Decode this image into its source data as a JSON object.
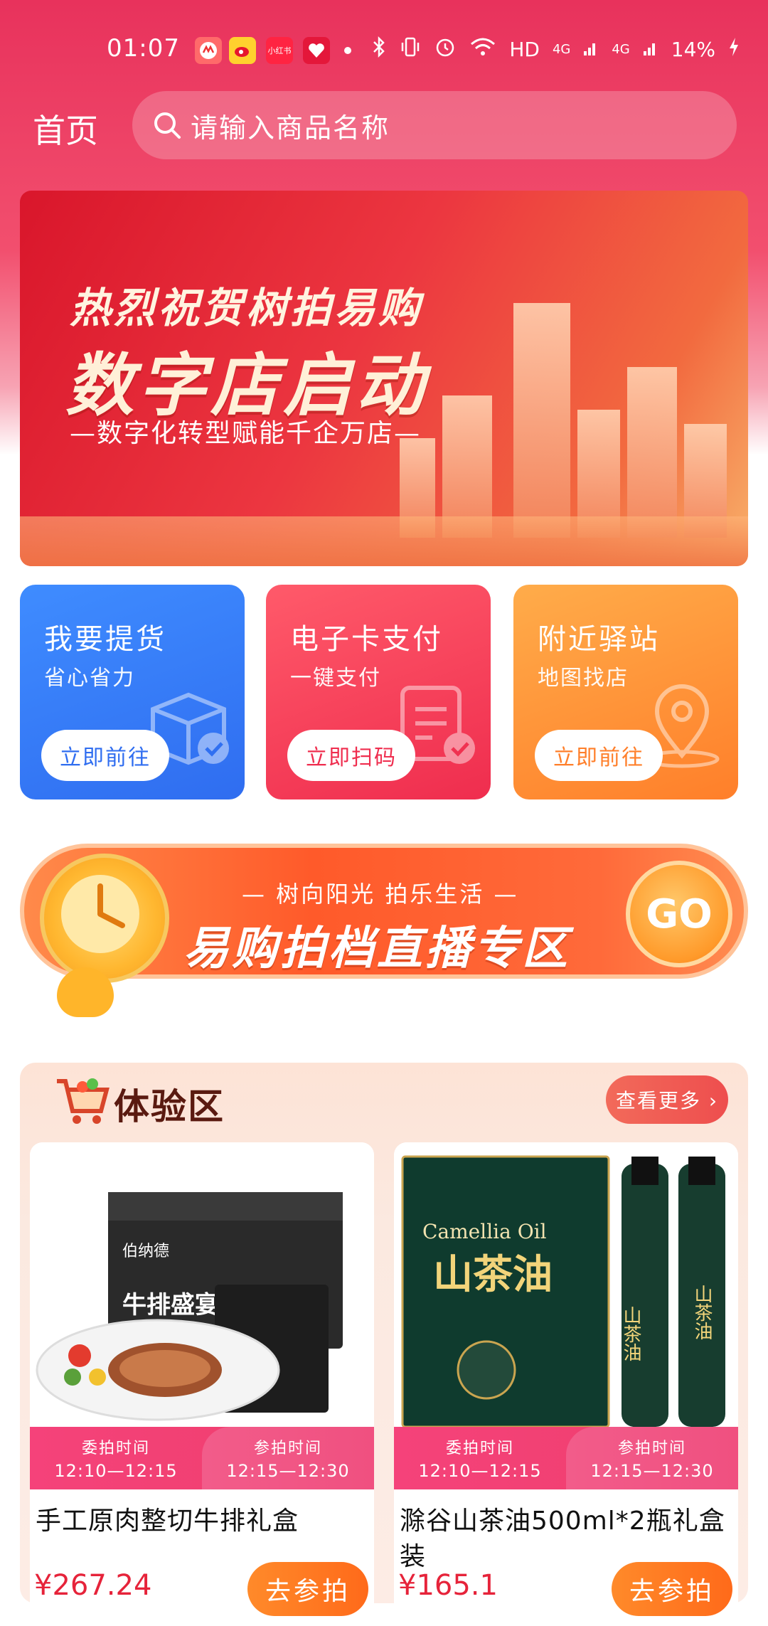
{
  "status_bar": {
    "time": "01:07",
    "network": "HD",
    "signal1": "4G",
    "signal2": "4G",
    "battery": "14%"
  },
  "header": {
    "title": "首页",
    "search_placeholder": "请输入商品名称"
  },
  "banner": {
    "line1": "热烈祝贺树拍易购",
    "line2": "数字店启动",
    "subtitle": "—数字化转型赋能千企万店—"
  },
  "quick_actions": [
    {
      "title": "我要提货",
      "subtitle": "省心省力",
      "button": "立即前往",
      "icon": "box-check-icon"
    },
    {
      "title": "电子卡支付",
      "subtitle": "一键支付",
      "button": "立即扫码",
      "icon": "document-check-icon"
    },
    {
      "title": "附近驿站",
      "subtitle": "地图找店",
      "button": "立即前往",
      "icon": "location-pin-icon"
    }
  ],
  "live_banner": {
    "subtitle": "— 树向阳光 拍乐生活 —",
    "title": "易购拍档直播专区",
    "go": "GO"
  },
  "experience": {
    "title": "体验区",
    "more": "查看更多 ›",
    "products": [
      {
        "name": "手工原肉整切牛排礼盒",
        "label_left": "委拍时间",
        "time_left": "12:10—12:15",
        "label_right": "参拍时间",
        "time_right": "12:15—12:30",
        "price": "¥267.24",
        "button": "去参拍",
        "box_brand": "伯纳德",
        "box_text": "牛排盛宴"
      },
      {
        "name": "滁谷山茶油500ml*2瓶礼盒装",
        "label_left": "委拍时间",
        "time_left": "12:10—12:15",
        "label_right": "参拍时间",
        "time_right": "12:15—12:30",
        "price": "¥165.1",
        "button": "去参拍",
        "box_en": "Camellia Oil",
        "box_cn": "山茶油",
        "bottle_text": "山茶油"
      }
    ]
  },
  "colors": {
    "brand_red": "#e8325c",
    "blue": "#2f6df0",
    "orange": "#ff7f2a",
    "price_red": "#e6233a"
  }
}
